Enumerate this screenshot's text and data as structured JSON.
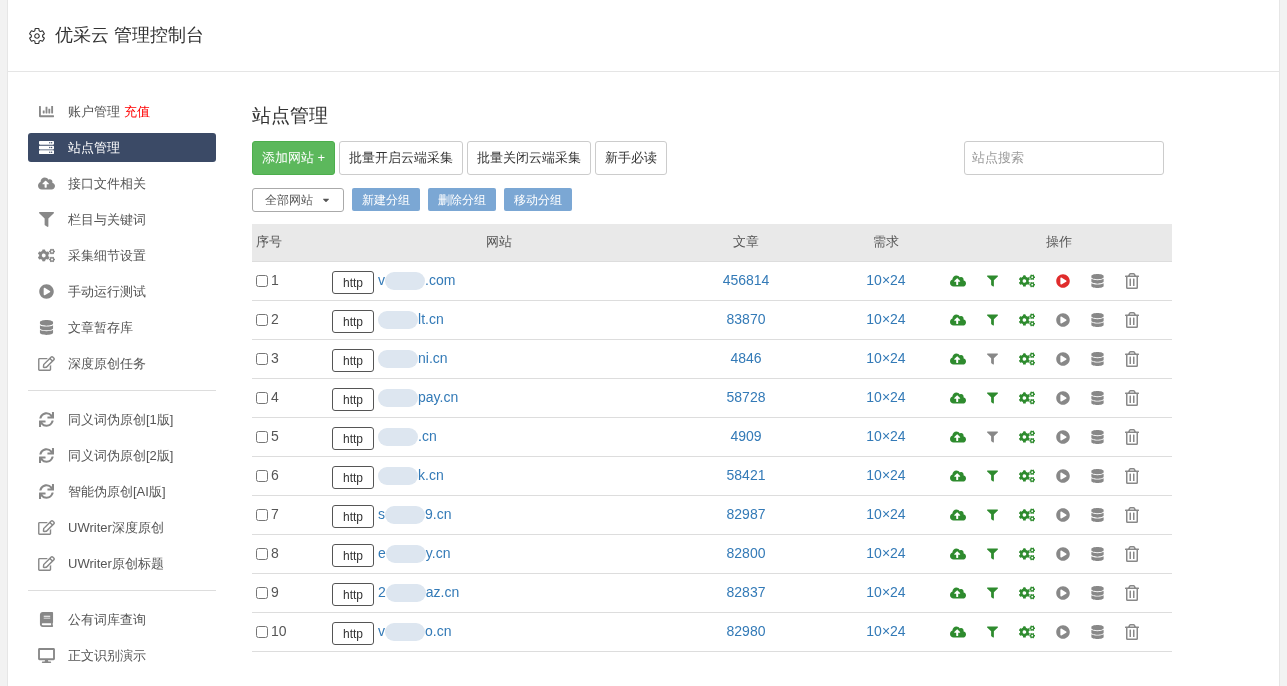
{
  "header": {
    "title": "优采云 管理控制台"
  },
  "sidebar": {
    "groups": [
      [
        {
          "label": "账户管理",
          "badge": "充值",
          "selected": false
        },
        {
          "label": "站点管理",
          "selected": true
        },
        {
          "label": "接口文件相关",
          "selected": false
        },
        {
          "label": "栏目与关键词",
          "selected": false
        },
        {
          "label": "采集细节设置",
          "selected": false
        },
        {
          "label": "手动运行测试",
          "selected": false
        },
        {
          "label": "文章暂存库",
          "selected": false
        },
        {
          "label": "深度原创任务",
          "selected": false
        }
      ],
      [
        {
          "label": "同义词伪原创[1版]",
          "selected": false
        },
        {
          "label": "同义词伪原创[2版]",
          "selected": false
        },
        {
          "label": "智能伪原创[AI版]",
          "selected": false
        },
        {
          "label": "UWriter深度原创",
          "selected": false
        },
        {
          "label": "UWriter原创标题",
          "selected": false
        }
      ],
      [
        {
          "label": "公有词库查询",
          "selected": false
        },
        {
          "label": "正文识别演示",
          "selected": false
        }
      ]
    ]
  },
  "main": {
    "title": "站点管理",
    "toolbar": [
      {
        "label": "添加网站 +",
        "kind": "primary"
      },
      {
        "label": "批量开启云端采集",
        "kind": "default"
      },
      {
        "label": "批量关闭云端采集",
        "kind": "default"
      },
      {
        "label": "新手必读",
        "kind": "default"
      }
    ],
    "search": {
      "placeholder": "站点搜索"
    },
    "group_select": {
      "value": "全部网站"
    },
    "group_buttons": [
      "新建分组",
      "删除分组",
      "移动分组"
    ],
    "table": {
      "columns": [
        "序号",
        "网站",
        "文章",
        "需求",
        "操作"
      ],
      "rows": [
        {
          "no": "1",
          "checked": false,
          "scheme": "http",
          "prefix": "v",
          "suffix": ".com",
          "articles": "456814",
          "demand": "10×24",
          "filter_on": true,
          "running": true
        },
        {
          "no": "2",
          "checked": false,
          "scheme": "http",
          "prefix": "",
          "suffix": "lt.cn",
          "articles": "83870",
          "demand": "10×24",
          "filter_on": true,
          "running": false
        },
        {
          "no": "3",
          "checked": false,
          "scheme": "http",
          "prefix": "",
          "suffix": "ni.cn",
          "articles": "4846",
          "demand": "10×24",
          "filter_on": false,
          "running": false
        },
        {
          "no": "4",
          "checked": false,
          "scheme": "http",
          "prefix": "",
          "suffix": "pay.cn",
          "articles": "58728",
          "demand": "10×24",
          "filter_on": true,
          "running": false
        },
        {
          "no": "5",
          "checked": false,
          "scheme": "http",
          "prefix": "",
          "suffix": ".cn",
          "articles": "4909",
          "demand": "10×24",
          "filter_on": false,
          "running": false
        },
        {
          "no": "6",
          "checked": false,
          "scheme": "http",
          "prefix": "",
          "suffix": "k.cn",
          "articles": "58421",
          "demand": "10×24",
          "filter_on": true,
          "running": false
        },
        {
          "no": "7",
          "checked": false,
          "scheme": "http",
          "prefix": "s",
          "suffix": "9.cn",
          "articles": "82987",
          "demand": "10×24",
          "filter_on": true,
          "running": false
        },
        {
          "no": "8",
          "checked": false,
          "scheme": "http",
          "prefix": "e",
          "suffix": "y.cn",
          "articles": "82800",
          "demand": "10×24",
          "filter_on": true,
          "running": false
        },
        {
          "no": "9",
          "checked": false,
          "scheme": "http",
          "prefix": "2",
          "suffix": "az.cn",
          "articles": "82837",
          "demand": "10×24",
          "filter_on": true,
          "running": false
        },
        {
          "no": "10",
          "checked": false,
          "scheme": "http",
          "prefix": "v",
          "suffix": "o.cn",
          "articles": "82980",
          "demand": "10×24",
          "filter_on": true,
          "running": false
        }
      ]
    }
  }
}
